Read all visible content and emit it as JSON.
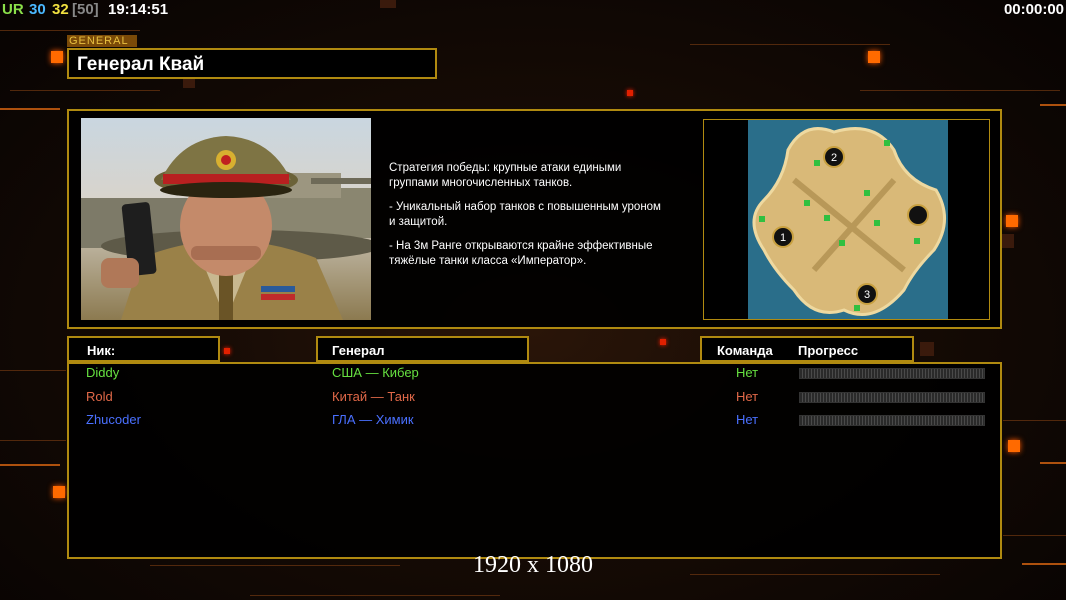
{
  "hud": {
    "ur_label": "UR",
    "n1": "30",
    "n2": "32",
    "n3": "[50]",
    "clock": "19:14:51",
    "timer": "00:00:00"
  },
  "general": {
    "tag": "GENERAL",
    "name": "Генерал Квай",
    "description": [
      "Стратегия победы: крупные атаки едиными\n группами многочисленных танков.",
      "- Уникальный набор танков с повышенным уроном\n и защитой.",
      "- На 3м Ранге открываются крайне эффективные\n тяжёлые танки класса «Император»."
    ]
  },
  "map": {
    "start_positions": [
      "1",
      "2",
      "3"
    ]
  },
  "headers": {
    "nick": "Ник:",
    "general": "Генерал",
    "team": "Команда",
    "progress": "Прогресс"
  },
  "players": [
    {
      "nick": "Diddy",
      "general": "США — Кибер",
      "team": "Нет",
      "color": "#66e040",
      "progress": 0
    },
    {
      "nick": "Rold",
      "general": "Китай — Танк",
      "team": "Нет",
      "color": "#e06848",
      "progress": 0
    },
    {
      "nick": "Zhucoder",
      "general": "ГЛА — Химик",
      "team": "Нет",
      "color": "#4a70ff",
      "progress": 0
    }
  ],
  "resolution": "1920 x 1080",
  "colors": {
    "frame": "#b08a10",
    "accent_orange": "#ff6a00"
  }
}
